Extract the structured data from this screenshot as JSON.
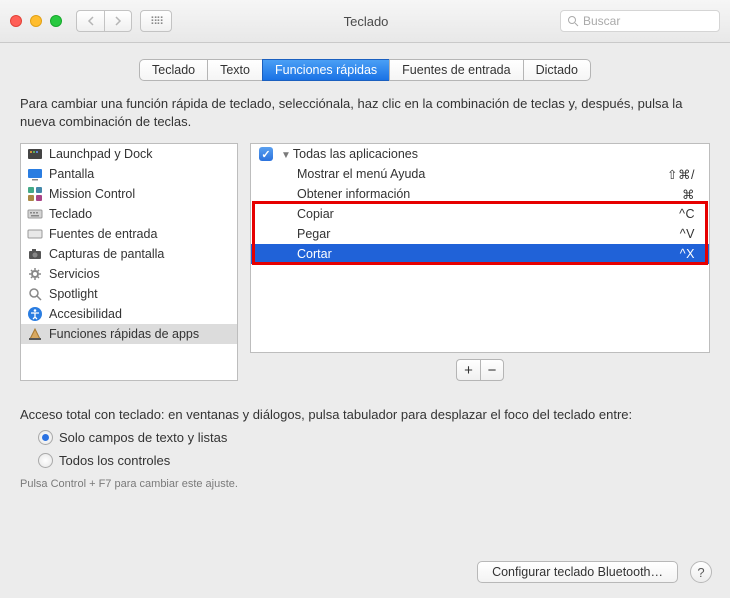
{
  "window": {
    "title": "Teclado",
    "search_placeholder": "Buscar"
  },
  "tabs": [
    "Teclado",
    "Texto",
    "Funciones rápidas",
    "Fuentes de entrada",
    "Dictado"
  ],
  "active_tab": 2,
  "instructions": "Para cambiar una función rápida de teclado, selecciónala, haz clic en la combinación de teclas y, después, pulsa la nueva combinación de teclas.",
  "sidebar": {
    "items": [
      {
        "label": "Launchpad y Dock",
        "icon": "launchpad"
      },
      {
        "label": "Pantalla",
        "icon": "display"
      },
      {
        "label": "Mission Control",
        "icon": "mission"
      },
      {
        "label": "Teclado",
        "icon": "keyboard"
      },
      {
        "label": "Fuentes de entrada",
        "icon": "input"
      },
      {
        "label": "Capturas de pantalla",
        "icon": "camera"
      },
      {
        "label": "Servicios",
        "icon": "gear"
      },
      {
        "label": "Spotlight",
        "icon": "spotlight"
      },
      {
        "label": "Accesibilidad",
        "icon": "accessibility"
      },
      {
        "label": "Funciones rápidas de apps",
        "icon": "appshortcut"
      }
    ],
    "selected": 9
  },
  "shortcuts": {
    "header": "Todas las aplicaciones",
    "checked": true,
    "items": [
      {
        "label": "Mostrar el menú Ayuda",
        "keys": "⇧⌘/"
      },
      {
        "label": "Obtener información",
        "keys": "⌘"
      },
      {
        "label": "Copiar",
        "keys": "^C"
      },
      {
        "label": "Pegar",
        "keys": "^V"
      },
      {
        "label": "Cortar",
        "keys": "^X"
      }
    ],
    "selected": 4,
    "highlight_start": 2,
    "highlight_end": 4
  },
  "access": {
    "label": "Acceso total con teclado: en ventanas y diálogos, pulsa tabulador para desplazar el foco del teclado entre:",
    "radios": [
      "Solo campos de texto y listas",
      "Todos los controles"
    ],
    "selected": 0,
    "hint": "Pulsa Control + F7 para cambiar este ajuste."
  },
  "footer": {
    "button": "Configurar teclado Bluetooth…"
  }
}
